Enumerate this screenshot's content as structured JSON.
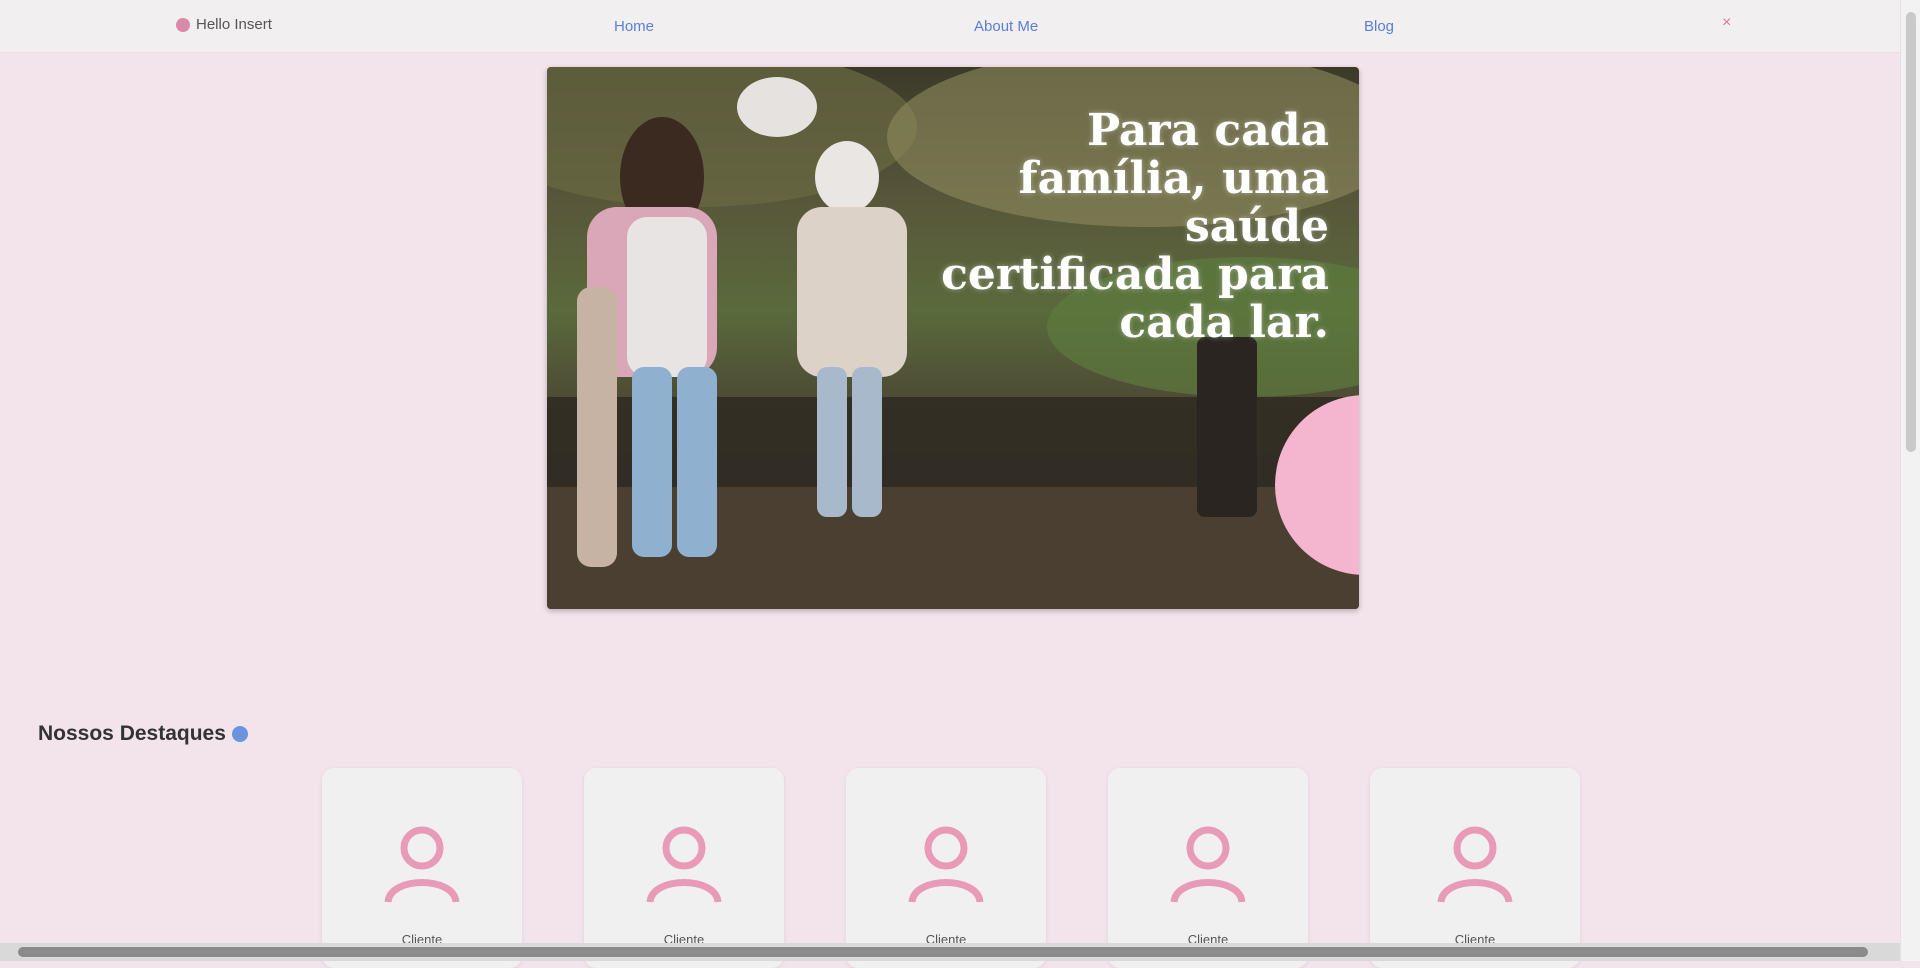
{
  "nav": {
    "brand": "Hello Insert",
    "links": [
      "Home",
      "About Me",
      "Blog"
    ],
    "close_glyph": "×"
  },
  "hero": {
    "heading": "Para cada família, uma saúde certificada para cada lar."
  },
  "section": {
    "title": "Nossos Destaques",
    "cards": [
      {
        "name": "Cliente"
      },
      {
        "name": "Cliente"
      },
      {
        "name": "Cliente"
      },
      {
        "name": "Cliente"
      },
      {
        "name": "Cliente"
      }
    ]
  },
  "colors": {
    "background": "#f3e3eb",
    "accent_pink": "#f4b6cf",
    "link_blue": "#5a7fd6",
    "icon_pink": "#e89ab7"
  },
  "icons": {
    "brand": "brand-logo-icon",
    "avatar": "user-avatar-icon",
    "section": "info-dot-icon",
    "close": "close-icon"
  }
}
